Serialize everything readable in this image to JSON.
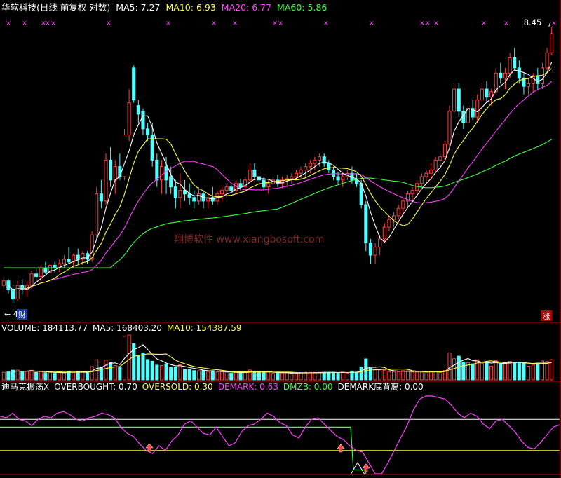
{
  "colors": {
    "up": "#ff4040",
    "down": "#54ffff",
    "ma5": "#ffffff",
    "ma10": "#ffff40",
    "ma20": "#ff40ff",
    "ma60": "#40ff40",
    "grid": "#c00000",
    "cross": "#ff40ff"
  },
  "header": {
    "title": "华软科技(日线 前复权 对数)",
    "ma5": "MA5: 7.27",
    "ma10": "MA10: 6.93",
    "ma20": "MA20: 6.77",
    "ma60": "MA60: 5.86"
  },
  "price_panel": {
    "high_label": "8.45",
    "low_label": "4.10",
    "badge_cai": "财",
    "badge_zhang": "涨",
    "watermark": "翔博软件 www.xiangbosoft.com"
  },
  "volume_panel": {
    "vol": "VOLUME: 184113.77",
    "ma5": "MA5: 168403.20",
    "ma10": "MA10: 154387.59"
  },
  "indicator_panel": {
    "name": "迪马克振荡X",
    "overbought": "OVERBOUGHT: 0.70",
    "oversold": "OVERSOLD: 0.30",
    "demark": "DEMARK: 0.63",
    "dmzb": "DMZB: 0.00",
    "divergence": "DEMARK底背离: 0.00"
  },
  "chart_data": [
    {
      "type": "candlestick",
      "scale": "log",
      "ylim": [
        4.1,
        8.45
      ],
      "series": [
        {
          "name": "MA5",
          "value": 7.27
        },
        {
          "name": "MA10",
          "value": 6.93
        },
        {
          "name": "MA20",
          "value": 6.77
        },
        {
          "name": "MA60",
          "value": 5.86
        }
      ],
      "ohlc": [
        [
          4.35,
          4.45,
          4.3,
          4.4
        ],
        [
          4.4,
          4.42,
          4.26,
          4.3
        ],
        [
          4.3,
          4.36,
          4.15,
          4.2
        ],
        [
          4.2,
          4.4,
          4.18,
          4.35
        ],
        [
          4.35,
          4.42,
          4.25,
          4.3
        ],
        [
          4.3,
          4.4,
          4.22,
          4.35
        ],
        [
          4.35,
          4.52,
          4.3,
          4.48
        ],
        [
          4.48,
          4.55,
          4.4,
          4.45
        ],
        [
          4.45,
          4.58,
          4.4,
          4.55
        ],
        [
          4.55,
          4.62,
          4.48,
          4.5
        ],
        [
          4.5,
          4.6,
          4.45,
          4.58
        ],
        [
          4.58,
          4.62,
          4.5,
          4.55
        ],
        [
          4.55,
          4.65,
          4.5,
          4.6
        ],
        [
          4.6,
          4.7,
          4.55,
          4.65
        ],
        [
          4.65,
          4.8,
          4.6,
          4.62
        ],
        [
          4.62,
          4.72,
          4.55,
          4.7
        ],
        [
          4.7,
          4.78,
          4.6,
          4.65
        ],
        [
          4.65,
          4.75,
          4.58,
          4.72
        ],
        [
          4.72,
          4.75,
          4.6,
          4.65
        ],
        [
          4.65,
          5.0,
          4.62,
          4.95
        ],
        [
          4.95,
          5.6,
          4.9,
          5.5
        ],
        [
          5.5,
          5.7,
          5.3,
          5.4
        ],
        [
          5.4,
          6.1,
          5.35,
          6.0
        ],
        [
          6.0,
          6.2,
          5.6,
          5.7
        ],
        [
          5.7,
          6.0,
          5.5,
          5.9
        ],
        [
          5.9,
          6.1,
          5.7,
          5.75
        ],
        [
          5.75,
          6.5,
          5.7,
          6.4
        ],
        [
          6.4,
          7.2,
          6.3,
          6.95
        ],
        [
          7.6,
          7.65,
          6.95,
          7.0
        ],
        [
          6.9,
          7.0,
          6.6,
          6.75
        ],
        [
          6.8,
          6.85,
          6.4,
          6.5
        ],
        [
          6.5,
          6.6,
          6.3,
          6.4
        ],
        [
          6.4,
          6.6,
          5.9,
          6.0
        ],
        [
          6.0,
          6.1,
          5.6,
          5.7
        ],
        [
          5.7,
          6.0,
          5.5,
          5.9
        ],
        [
          5.9,
          6.05,
          5.5,
          5.7
        ],
        [
          5.75,
          5.9,
          5.5,
          5.6
        ],
        [
          5.6,
          5.7,
          5.3,
          5.45
        ],
        [
          5.45,
          5.8,
          5.3,
          5.55
        ],
        [
          5.55,
          5.7,
          5.4,
          5.5
        ],
        [
          5.5,
          5.65,
          5.35,
          5.45
        ],
        [
          5.45,
          5.55,
          5.3,
          5.4
        ],
        [
          5.4,
          5.6,
          5.35,
          5.5
        ],
        [
          5.5,
          5.55,
          5.3,
          5.4
        ],
        [
          5.4,
          5.5,
          5.3,
          5.45
        ],
        [
          5.45,
          5.6,
          5.35,
          5.4
        ],
        [
          5.4,
          5.55,
          5.35,
          5.5
        ],
        [
          5.5,
          5.6,
          5.4,
          5.55
        ],
        [
          5.55,
          5.65,
          5.45,
          5.6
        ],
        [
          5.6,
          5.65,
          5.5,
          5.55
        ],
        [
          5.55,
          5.7,
          5.5,
          5.65
        ],
        [
          5.65,
          5.72,
          5.55,
          5.6
        ],
        [
          5.6,
          5.75,
          5.55,
          5.7
        ],
        [
          5.7,
          5.95,
          5.65,
          5.85
        ],
        [
          5.85,
          5.95,
          5.7,
          5.75
        ],
        [
          5.75,
          5.8,
          5.6,
          5.7
        ],
        [
          5.7,
          5.75,
          5.55,
          5.6
        ],
        [
          5.6,
          5.7,
          5.5,
          5.65
        ],
        [
          5.65,
          5.75,
          5.6,
          5.7
        ],
        [
          5.7,
          5.78,
          5.6,
          5.65
        ],
        [
          5.65,
          5.75,
          5.58,
          5.7
        ],
        [
          5.7,
          5.78,
          5.6,
          5.72
        ],
        [
          5.72,
          5.8,
          5.65,
          5.75
        ],
        [
          5.75,
          5.85,
          5.7,
          5.8
        ],
        [
          5.8,
          5.9,
          5.72,
          5.85
        ],
        [
          5.85,
          5.95,
          5.75,
          5.9
        ],
        [
          5.9,
          6.0,
          5.8,
          5.95
        ],
        [
          5.95,
          6.05,
          5.85,
          6.0
        ],
        [
          6.0,
          6.1,
          5.9,
          6.05
        ],
        [
          6.05,
          6.1,
          5.9,
          5.95
        ],
        [
          5.95,
          6.0,
          5.8,
          5.85
        ],
        [
          5.85,
          5.9,
          5.7,
          5.75
        ],
        [
          5.75,
          5.82,
          5.65,
          5.7
        ],
        [
          5.7,
          5.8,
          5.6,
          5.75
        ],
        [
          5.75,
          5.85,
          5.7,
          5.8
        ],
        [
          5.8,
          5.9,
          5.65,
          5.7
        ],
        [
          5.7,
          5.8,
          5.6,
          5.65
        ],
        [
          5.65,
          5.7,
          5.3,
          5.35
        ],
        [
          5.35,
          5.4,
          4.75,
          4.85
        ],
        [
          4.85,
          4.9,
          4.6,
          4.7
        ],
        [
          4.7,
          4.85,
          4.6,
          4.8
        ],
        [
          4.8,
          4.95,
          4.7,
          4.9
        ],
        [
          4.9,
          5.1,
          4.85,
          5.05
        ],
        [
          5.05,
          5.2,
          5.0,
          5.15
        ],
        [
          5.15,
          5.25,
          5.05,
          5.2
        ],
        [
          5.2,
          5.35,
          5.15,
          5.3
        ],
        [
          5.3,
          5.45,
          5.2,
          5.4
        ],
        [
          5.4,
          5.55,
          5.3,
          5.5
        ],
        [
          5.5,
          5.6,
          5.4,
          5.55
        ],
        [
          5.55,
          5.7,
          5.5,
          5.65
        ],
        [
          5.65,
          5.8,
          5.6,
          5.75
        ],
        [
          5.75,
          5.85,
          5.65,
          5.8
        ],
        [
          5.8,
          5.95,
          5.7,
          5.85
        ],
        [
          5.85,
          6.05,
          5.8,
          6.0
        ],
        [
          6.0,
          6.1,
          5.9,
          6.05
        ],
        [
          6.05,
          6.3,
          6.0,
          6.25
        ],
        [
          6.25,
          6.9,
          6.2,
          6.8
        ],
        [
          6.8,
          7.3,
          6.75,
          7.2
        ],
        [
          7.2,
          7.3,
          6.7,
          6.8
        ],
        [
          6.8,
          6.9,
          6.5,
          6.6
        ],
        [
          6.6,
          6.9,
          6.5,
          6.85
        ],
        [
          6.85,
          7.0,
          6.65,
          6.7
        ],
        [
          6.7,
          7.1,
          6.6,
          7.0
        ],
        [
          7.0,
          7.3,
          6.9,
          7.2
        ],
        [
          7.2,
          7.35,
          6.95,
          7.05
        ],
        [
          7.05,
          7.2,
          6.9,
          7.15
        ],
        [
          7.15,
          7.6,
          7.1,
          7.5
        ],
        [
          7.5,
          7.7,
          7.3,
          7.4
        ],
        [
          7.4,
          7.6,
          7.2,
          7.5
        ],
        [
          7.5,
          7.9,
          7.4,
          7.8
        ],
        [
          7.8,
          8.0,
          7.55,
          7.6
        ],
        [
          7.6,
          7.75,
          7.3,
          7.4
        ],
        [
          7.4,
          7.5,
          7.1,
          7.25
        ],
        [
          7.25,
          7.4,
          7.1,
          7.3
        ],
        [
          7.3,
          7.5,
          7.15,
          7.45
        ],
        [
          7.45,
          7.6,
          7.2,
          7.3
        ],
        [
          7.3,
          7.7,
          7.2,
          7.6
        ],
        [
          7.6,
          8.0,
          7.5,
          7.9
        ],
        [
          7.9,
          8.45,
          7.85,
          8.3
        ]
      ]
    },
    {
      "type": "bar",
      "series": [
        {
          "name": "VOLUME",
          "value": 184113.77
        },
        {
          "name": "MA5",
          "value": 168403.2
        },
        {
          "name": "MA10",
          "value": 154387.59
        }
      ]
    },
    {
      "type": "line",
      "series": [
        {
          "name": "OVERBOUGHT",
          "value": 0.7
        },
        {
          "name": "OVERSOLD",
          "value": 0.3
        },
        {
          "name": "DEMARK",
          "value": 0.63
        },
        {
          "name": "DMZB",
          "value": 0.0
        },
        {
          "name": "DEMARK底背离",
          "value": 0.0
        }
      ],
      "demark": [
        0.74,
        0.72,
        0.78,
        0.7,
        0.68,
        0.62,
        0.7,
        0.74,
        0.72,
        0.78,
        0.8,
        0.76,
        0.7,
        0.68,
        0.72,
        0.74,
        0.78,
        0.76,
        0.72,
        0.6,
        0.52,
        0.48,
        0.38,
        0.3,
        0.26,
        0.36,
        0.3,
        0.42,
        0.5,
        0.64,
        0.68,
        0.6,
        0.52,
        0.5,
        0.6,
        0.48,
        0.36,
        0.4,
        0.54,
        0.62,
        0.64,
        0.7,
        0.78,
        0.74,
        0.66,
        0.62,
        0.5,
        0.46,
        0.6,
        0.7,
        0.72,
        0.64,
        0.56,
        0.48,
        0.44,
        0.36,
        0.3,
        0.28,
        0.14,
        0.0,
        0.0,
        0.14,
        0.3,
        0.46,
        0.62,
        0.82,
        0.96,
        1.0,
        1.0,
        0.98,
        0.96,
        0.88,
        0.78,
        0.72,
        0.78,
        0.74,
        0.64,
        0.58,
        0.68,
        0.7,
        0.62,
        0.54,
        0.42,
        0.34,
        0.32,
        0.4,
        0.5,
        0.6,
        0.63
      ]
    }
  ]
}
